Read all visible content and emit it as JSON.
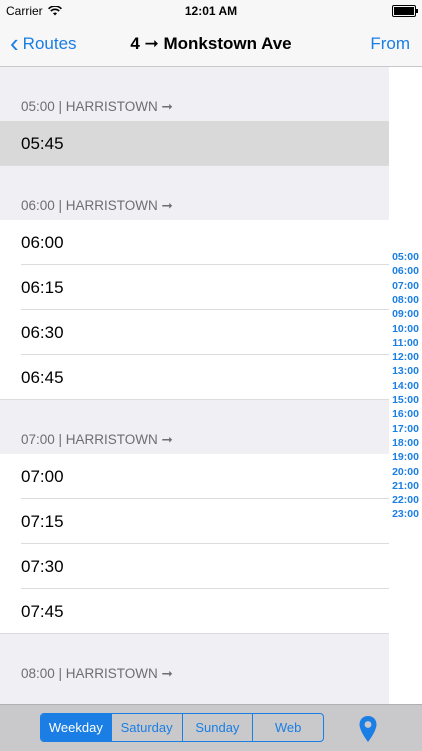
{
  "status_bar": {
    "carrier": "Carrier",
    "time": "12:01 AM"
  },
  "nav": {
    "back_label": "Routes",
    "title": "4 ➞ Monkstown Ave",
    "from_label": "From"
  },
  "sections": [
    {
      "header": "05:00 | HARRISTOWN ➞",
      "rows": [
        "05:45"
      ],
      "selected_index": 0
    },
    {
      "header": "06:00 | HARRISTOWN ➞",
      "rows": [
        "06:00",
        "06:15",
        "06:30",
        "06:45"
      ]
    },
    {
      "header": "07:00 | HARRISTOWN ➞",
      "rows": [
        "07:00",
        "07:15",
        "07:30",
        "07:45"
      ]
    },
    {
      "header": "08:00 | HARRISTOWN ➞",
      "rows": []
    }
  ],
  "index": [
    "05:00",
    "06:00",
    "07:00",
    "08:00",
    "09:00",
    "10:00",
    "11:00",
    "12:00",
    "13:00",
    "14:00",
    "15:00",
    "16:00",
    "17:00",
    "18:00",
    "19:00",
    "20:00",
    "21:00",
    "22:00",
    "23:00"
  ],
  "toolbar": {
    "segments": [
      "Weekday",
      "Saturday",
      "Sunday",
      "Web"
    ],
    "active_segment": "Weekday",
    "location_icon": "map-pin-icon"
  },
  "colors": {
    "accent": "#1a7ee4",
    "selected_row": "#d9d9d9",
    "background": "#efeff4"
  }
}
